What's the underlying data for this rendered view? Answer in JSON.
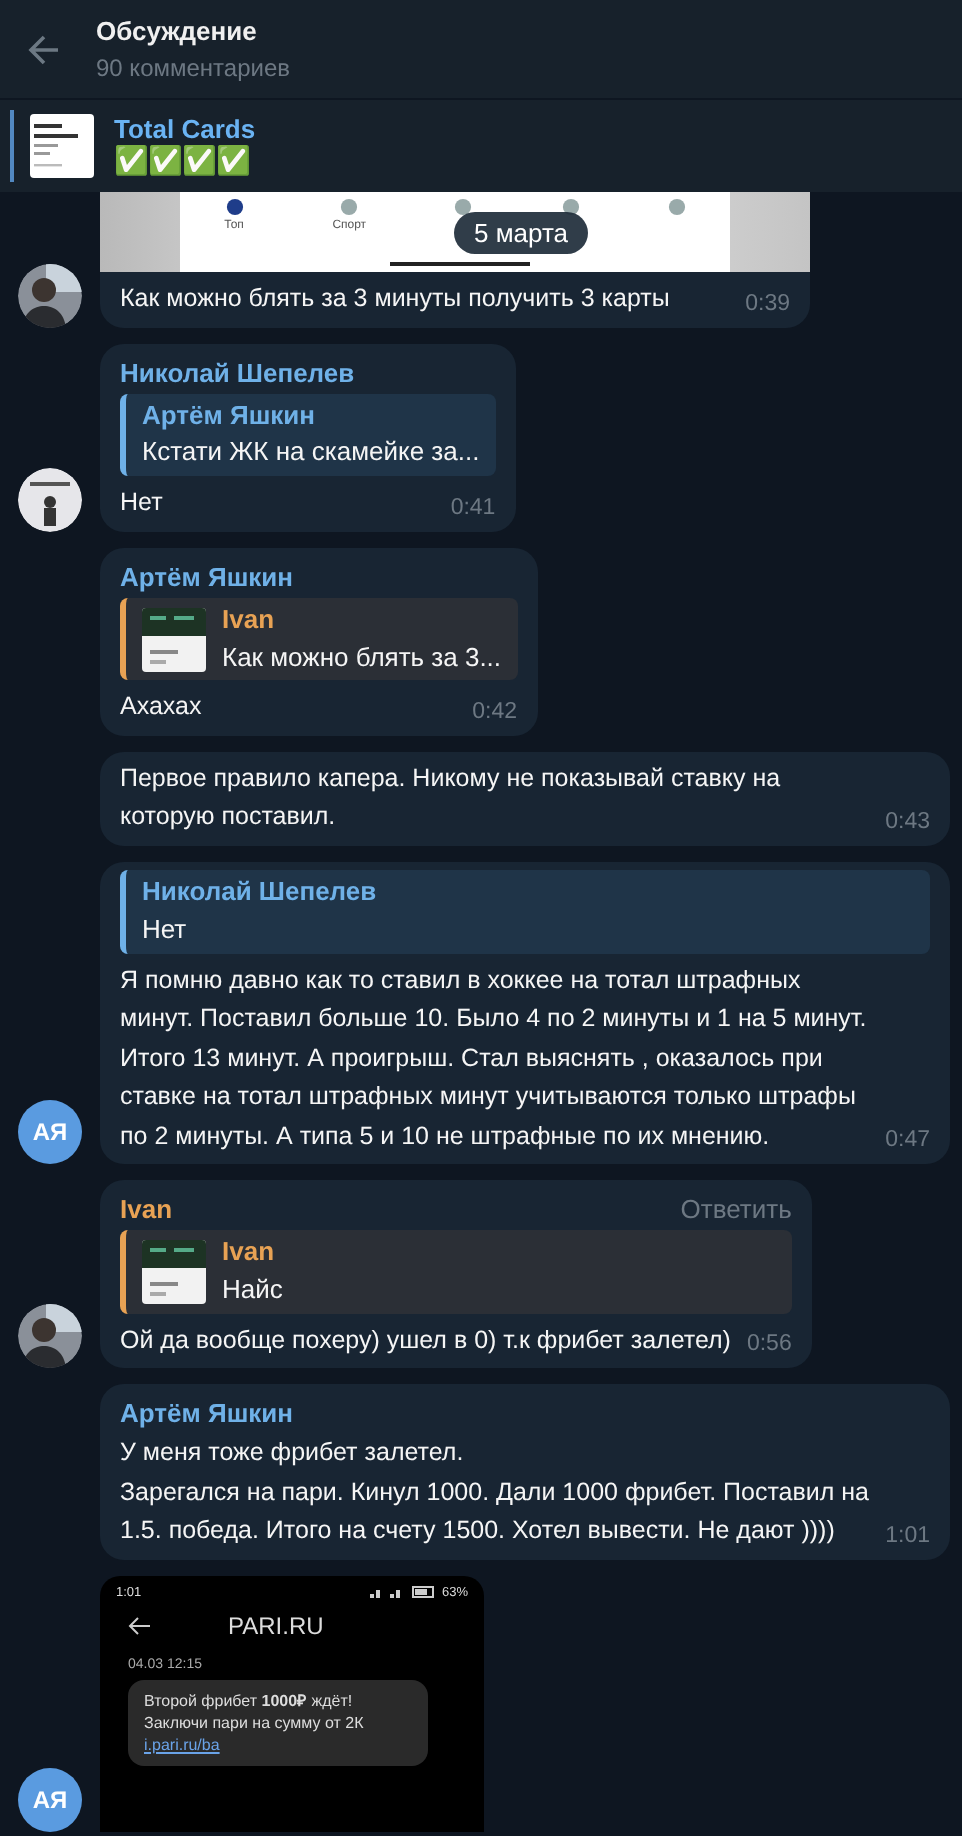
{
  "header": {
    "title": "Обсуждение",
    "subtitle": "90 комментариев"
  },
  "pinned": {
    "title": "Total Cards",
    "text": "✅✅✅✅"
  },
  "date_pill": "5 марта",
  "messages": [
    {
      "image": {
        "kind": "tabbar",
        "tabs": [
          {
            "label": "Топ",
            "selected": true
          },
          {
            "label": "Спорт",
            "selected": false
          },
          {
            "selected": false
          },
          {
            "selected": false
          },
          {
            "selected": false
          }
        ]
      },
      "text": "Как можно блять за 3 минуты получить 3 карты",
      "time": "0:39"
    },
    {
      "avatar": {
        "kind": "photo2"
      },
      "author": {
        "name": "Николай Шепелев",
        "color": "#6fb1e8"
      },
      "reply": {
        "author": {
          "name": "Артём Яшкин",
          "color": "#6fb1e8"
        },
        "text": "Кстати ЖК на скамейке за...",
        "thumb": false
      },
      "text": "Нет",
      "time": "0:41"
    },
    {
      "author": {
        "name": "Артём Яшкин",
        "color": "#6fb1e8"
      },
      "reply": {
        "author": {
          "name": "Ivan",
          "color": "#e8a254"
        },
        "text": "Как можно блять за 3...",
        "thumb": true
      },
      "text": "Ахахах",
      "time": "0:42"
    },
    {
      "text": "Первое правило капера. Никому не показывай ставку на которую поставил.",
      "time": "0:43"
    },
    {
      "avatar": {
        "kind": "initials",
        "initials": "АЯ",
        "color": "#5a9be0"
      },
      "reply": {
        "author": {
          "name": "Николай Шепелев",
          "color": "#6fb1e8"
        },
        "text": "Нет",
        "thumb": false
      },
      "text": "Я помню давно как то ставил в хоккее на тотал штрафных минут. Поставил больше 10. Было 4 по 2 минуты и 1 на 5 минут. Итого 13 минут. А проигрыш. Стал выяснять , оказалось при ставке на тотал штрафных минут учитываются только штрафы по 2 минуты. А типа 5 и 10 не штрафные по их мнению.",
      "time": "0:47"
    },
    {
      "author": {
        "name": "Ivan",
        "color": "#e8a254"
      },
      "reply_action": "Ответить",
      "reply": {
        "author": {
          "name": "Ivan",
          "color": "#e8a254"
        },
        "text": "Найс",
        "thumb": true
      },
      "text": "Ой да вообще похеру) ушел в 0) т.к фрибет залетел)",
      "time": "0:56"
    },
    {
      "author": {
        "name": "Артём Яшкин",
        "color": "#6fb1e8"
      },
      "text": "У меня тоже фрибет залетел.\nЗарегался на пари. Кинул 1000. Дали 1000 фрибет. Поставил на 1.5. победа. Итого на счету 1500. Хотел вывести. Не дают ))))",
      "time": "1:01"
    },
    {
      "avatar": {
        "kind": "initials",
        "initials": "АЯ",
        "color": "#5a9be0"
      },
      "image": {
        "kind": "phone",
        "clock": "1:01",
        "battery": "63%",
        "app_title": "PARI.RU",
        "sms_date": "04.03 12:15",
        "sms_text": "Второй фрибет **1000₽** ждёт! Заключи пари на сумму от 2К",
        "sms_link": "i.pari.ru/ba"
      }
    }
  ]
}
